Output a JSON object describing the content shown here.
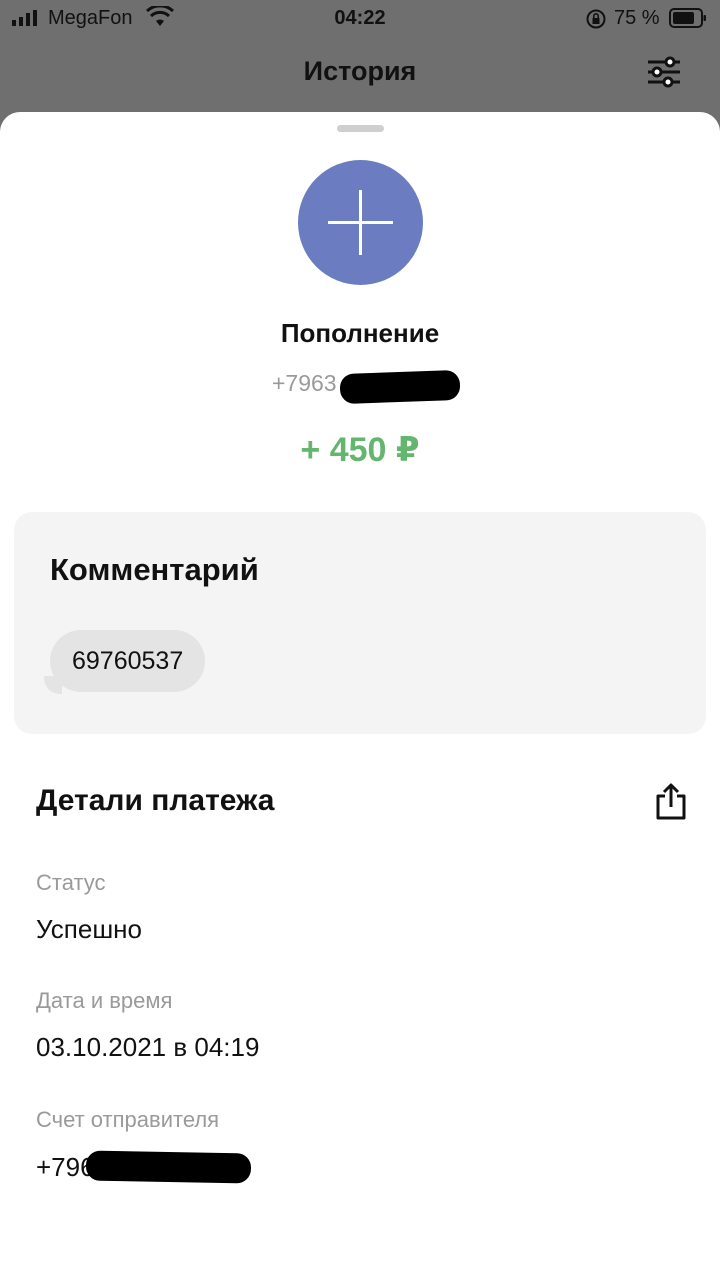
{
  "status_bar": {
    "carrier": "MegaFon",
    "time": "04:22",
    "battery_percent": "75 %"
  },
  "nav": {
    "title": "История",
    "filter_icon": "sliders-icon"
  },
  "transaction": {
    "icon": "plus-icon",
    "title": "Пополнение",
    "phone_visible": "+7963",
    "amount": "+ 450 ₽",
    "amount_color": "#64b56d",
    "avatar_color": "#6b7dc0"
  },
  "comment": {
    "heading": "Комментарий",
    "text": "69760537"
  },
  "details": {
    "heading": "Детали платежа",
    "share_icon": "share-icon",
    "fields": [
      {
        "label": "Статус",
        "value": "Успешно"
      },
      {
        "label": "Дата и время",
        "value": "03.10.2021 в 04:19"
      },
      {
        "label": "Счет отправителя",
        "value": "+796"
      }
    ]
  }
}
